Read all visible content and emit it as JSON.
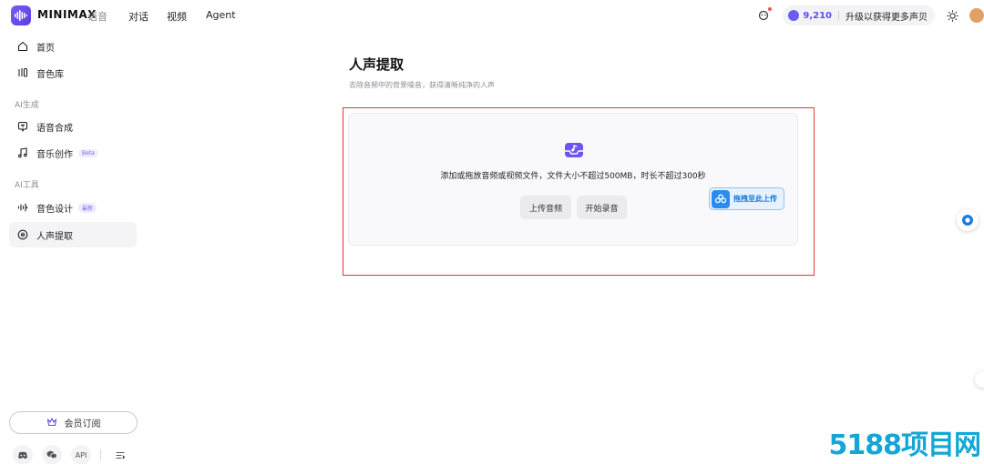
{
  "header": {
    "brand": "MINIMAX",
    "brand_sub": "语音",
    "nav": [
      "对话",
      "视频",
      "Agent"
    ],
    "credits": "9,210",
    "upgrade": "升级以获得更多声贝"
  },
  "sidebar": {
    "items": [
      {
        "label": "首页",
        "icon": "home-icon"
      },
      {
        "label": "音色库",
        "icon": "voice-library-icon"
      },
      {
        "label": "语音合成",
        "icon": "speech-synthesis-icon"
      },
      {
        "label": "音乐创作",
        "icon": "music-note-icon",
        "badge": "Beta"
      },
      {
        "label": "音色设计",
        "icon": "waveform-icon",
        "badge": "最新"
      },
      {
        "label": "人声提取",
        "icon": "vocal-extract-icon"
      }
    ],
    "sections": [
      "AI生成",
      "AI工具"
    ],
    "member_button": "会员订阅",
    "footer": {
      "api": "API"
    }
  },
  "main": {
    "title": "人声提取",
    "subtitle": "去除音频中的背景噪音，获得清晰纯净的人声",
    "hint": "添加或拖放音频或视频文件，文件大小不超过500MB，时长不超过300秒",
    "upload_button": "上传音频",
    "record_button": "开始录音",
    "drag_label": "拖拽至此上传"
  },
  "watermark": "5188项目网",
  "colors": {
    "accent": "#5b4ef0",
    "highlight": "#e03a2f",
    "drag": "#2a8cf0"
  }
}
